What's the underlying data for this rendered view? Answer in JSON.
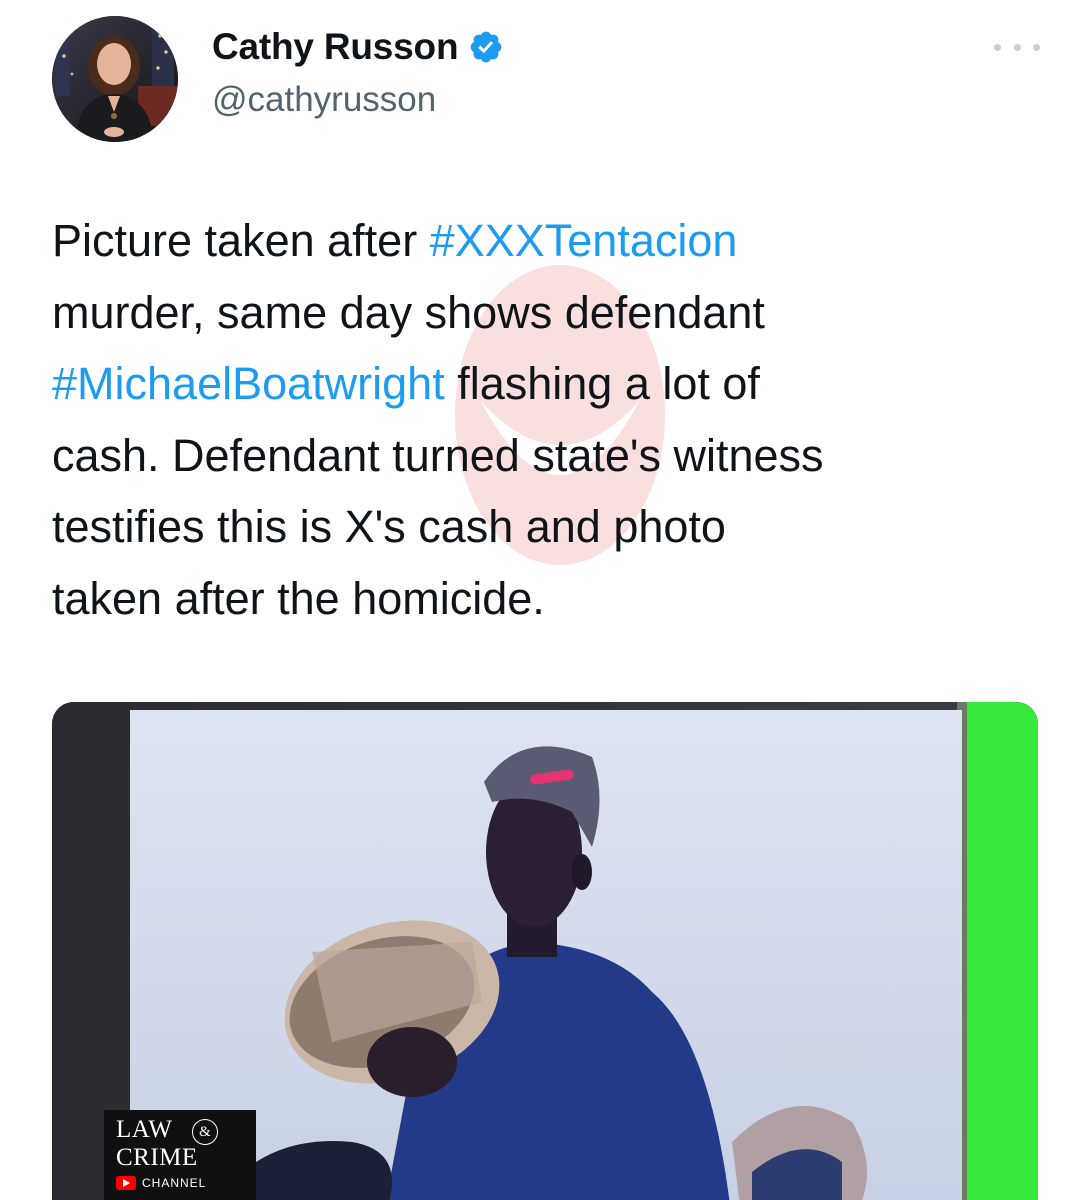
{
  "author": {
    "display_name": "Cathy Russon",
    "handle": "@cathyrusson",
    "verified": true
  },
  "tweet": {
    "lines": [
      [
        {
          "text": "Picture taken after ",
          "type": "text"
        },
        {
          "text": "#XXXTentacion",
          "type": "hashtag"
        }
      ],
      [
        {
          "text": "murder, same day shows defendant",
          "type": "text"
        }
      ],
      [
        {
          "text": "#MichaelBoatwright",
          "type": "hashtag"
        },
        {
          "text": " flashing a lot of",
          "type": "text"
        }
      ],
      [
        {
          "text": "cash. Defendant turned state's witness",
          "type": "text"
        }
      ],
      [
        {
          "text": "testifies this is X's cash and photo",
          "type": "text"
        }
      ],
      [
        {
          "text": "taken after the homicide.",
          "type": "text"
        }
      ]
    ]
  },
  "media": {
    "logo": {
      "line1": "LAW",
      "amp": "&",
      "line2": "CRIME",
      "channel": "CHANNEL"
    }
  },
  "colors": {
    "hashtag": "#1d9bf0",
    "text": "#0f1419",
    "secondary": "#536471",
    "verified": "#1d9bf0"
  },
  "icons": {
    "verified": "verified-badge-icon",
    "more": "more-options-icon"
  }
}
